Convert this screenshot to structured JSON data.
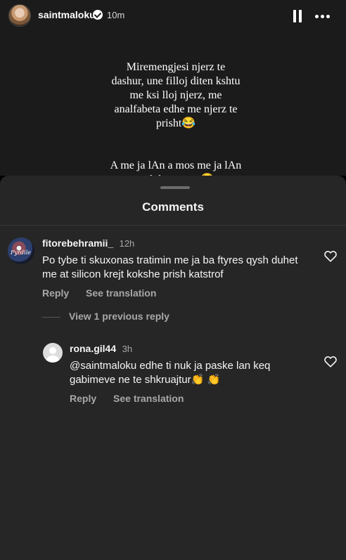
{
  "story": {
    "username": "saintmaloku",
    "time": "10m",
    "text_paragraph_1": "Miremengjesi njerz te\ndashur, une filloj diten kshtu\nme ksi lloj njerz, me\nanalfabeta edhe me njerz te\nprisht😂",
    "text_paragraph_2": "A me ja lAn a mos me ja lAn\ntash komentet😂"
  },
  "comments_sheet": {
    "title": "Comments",
    "comments": [
      {
        "username": "fitorebehramii_",
        "time": "12h",
        "text": "Po tybe ti skuxonas tratimin me ja ba ftyres qysh duhet  me at silicon krejt kokshe prish katstrof",
        "reply_label": "Reply",
        "translate_label": "See translation"
      }
    ],
    "view_replies_label": "View 1 previous reply",
    "replies": [
      {
        "username": "rona.gil44",
        "time": "3h",
        "text": "@saintmaloku edhe ti nuk ja paske lan keq gabimeve ne te shkruajtur👏 👏",
        "reply_label": "Reply",
        "translate_label": "See translation"
      }
    ]
  },
  "colors": {
    "story_bg": "#1b1b1b",
    "sheet_bg": "#262626",
    "secondary_text": "#a8a8a8"
  },
  "icons": [
    "verified-badge-icon",
    "pause-icon",
    "more-icon",
    "heart-icon"
  ]
}
